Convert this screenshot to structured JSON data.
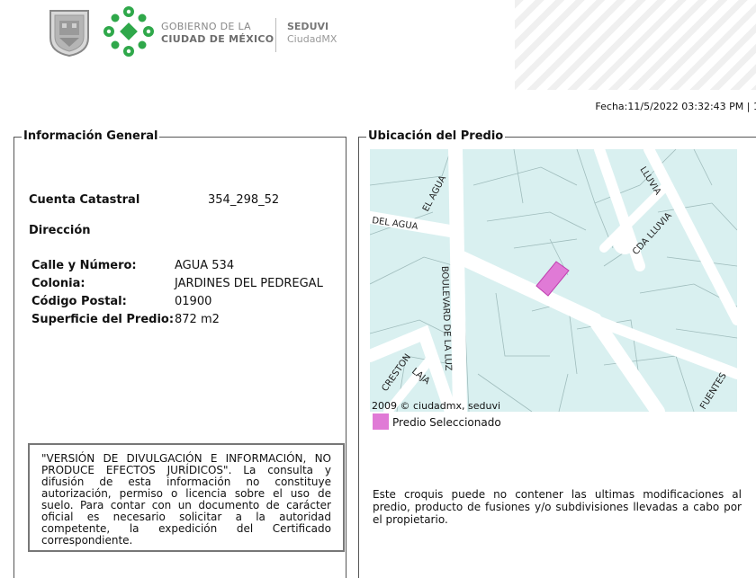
{
  "header": {
    "gov_line1": "GOBIERNO DE LA",
    "gov_line2": "CIUDAD DE MÉXICO",
    "agency_name": "SEDUVI",
    "agency_sub": "CiudadMX",
    "icons": {
      "seal": "coat-of-arms-icon",
      "brand": "cdmx-logo-icon"
    },
    "colors": {
      "brand_green": "#2fa84a"
    }
  },
  "fecha": "Fecha:11/5/2022 03:32:43 PM | 1",
  "info": {
    "title": "Información General",
    "cuenta_label": "Cuenta Catastral",
    "cuenta_value": "354_298_52",
    "direccion_label": "Dirección",
    "calle_label": "Calle y Número:",
    "calle_value": "AGUA 534",
    "colonia_label": "Colonia:",
    "colonia_value": "JARDINES DEL PEDREGAL",
    "cp_label": "Código Postal:",
    "cp_value": "01900",
    "superficie_label": "Superficie del Predio:",
    "superficie_value": "872 m2",
    "disclaimer": "\"VERSIÓN DE DIVULGACIÓN E INFORMACIÓN, NO PRODUCE EFECTOS JURÍDICOS\". La consulta y difusión de esta información no constituye autorización, permiso o licencia sobre el uso de suelo. Para contar con un documento de carácter oficial es necesario solicitar a la autoridad competente, la expedición del Certificado correspondiente."
  },
  "ubicacion": {
    "title": "Ubicación del Predio",
    "streets": {
      "del_agua": "DEL AGUA",
      "el_agua": "EL AGUA",
      "lluvia": "LLUVIA",
      "cda_lluvia": "CDA LLUVIA",
      "boulevard": "BOULEVARD DE LA LUZ",
      "creston": "CRESTON",
      "laja": "LAJA",
      "fuentes": "FUENTES"
    },
    "credit": "2009 © ciudadmx, seduvi",
    "legend_label": "Predio Seleccionado",
    "legend_color": "#e07ad6",
    "map_bg_color": "#d9f0f0",
    "note": "Este croquis puede no contener las ultimas modificaciones al predio, producto de fusiones y/o subdivisiones llevadas a cabo por el propietario."
  }
}
